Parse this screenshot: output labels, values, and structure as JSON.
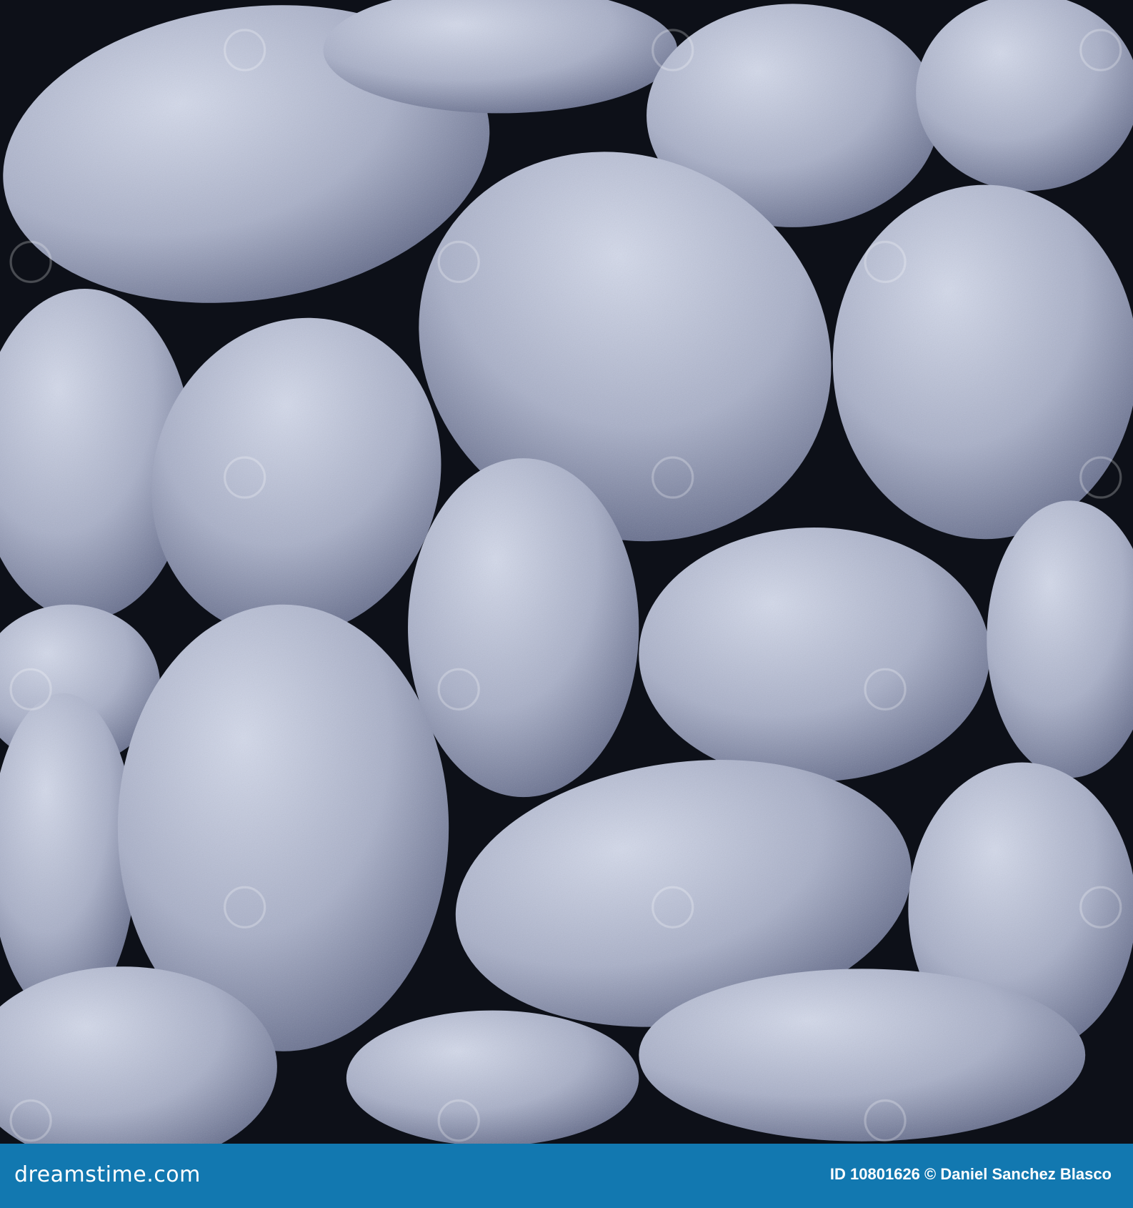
{
  "photo": {
    "subject": "blue-toned pebbles",
    "watermark": "dreamstime"
  },
  "footer": {
    "brand": "dreamstime.com",
    "credit": "ID 10801626 © Daniel Sanchez Blasco"
  },
  "colors": {
    "footer_bg": "#1278b0",
    "stone_light": "#c9cfe0",
    "stone_dark": "#5c6480",
    "gap": "#0d1018"
  }
}
